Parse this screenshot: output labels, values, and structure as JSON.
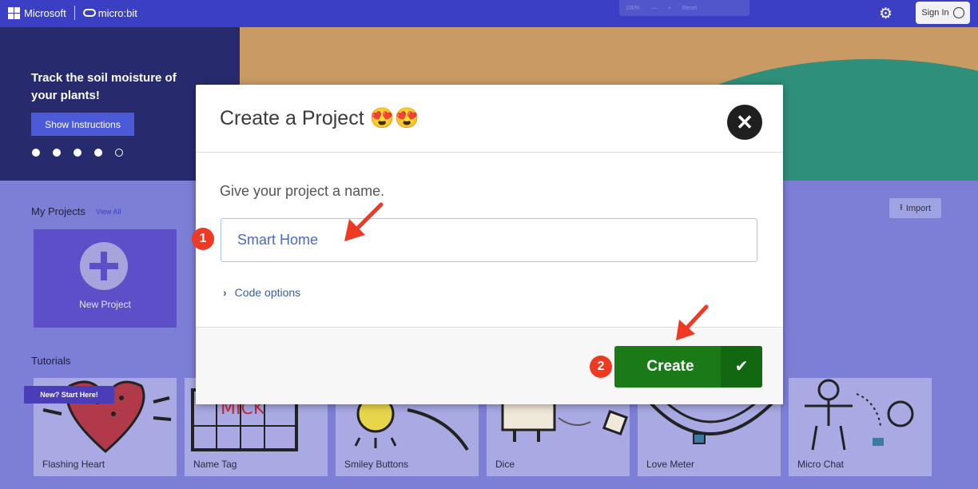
{
  "header": {
    "microsoft": "Microsoft",
    "microbit": "micro:bit",
    "zoom": {
      "value": "100%",
      "minus": "—",
      "plus": "+",
      "reset": "Reset"
    },
    "gear_icon": "gear-icon",
    "signin": "Sign In"
  },
  "hero": {
    "title": "Track the soil moisture of your plants!",
    "button": "Show Instructions"
  },
  "projects": {
    "title": "My Projects",
    "view_all": "View All",
    "import": "Import",
    "new_project": "New Project"
  },
  "tutorials": {
    "title": "Tutorials",
    "ribbon": "New? Start Here!",
    "items": [
      "Flashing Heart",
      "Name Tag",
      "Smiley Buttons",
      "Dice",
      "Love Meter",
      "Micro Chat"
    ]
  },
  "dialog": {
    "title": "Create a Project 😍😍",
    "close_icon": "close-icon",
    "prompt": "Give your project a name.",
    "input_value": "Smart Home",
    "code_options": "Code options",
    "create": "Create",
    "check_icon": "check-icon"
  },
  "annotations": {
    "marker1": "1",
    "marker2": "2",
    "color": "#ee3a22"
  }
}
